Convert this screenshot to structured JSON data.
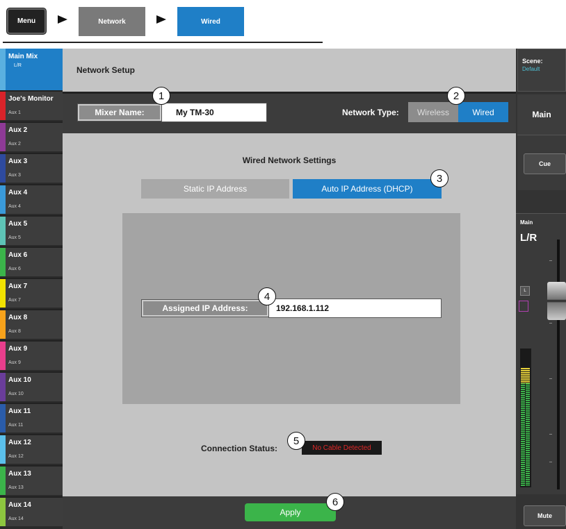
{
  "breadcrumb": {
    "menu": "Menu",
    "network": "Network",
    "wired": "Wired"
  },
  "mixes": {
    "main": {
      "name": "Main Mix",
      "sub": "L/R",
      "color": "#1f7fc7"
    },
    "items": [
      {
        "name": "Joe's Monitor",
        "sub": "Aux 1",
        "color": "#d8232a"
      },
      {
        "name": "Aux 2",
        "sub": "Aux 2",
        "color": "#8e3a96"
      },
      {
        "name": "Aux 3",
        "sub": "Aux 3",
        "color": "#2e4a9e"
      },
      {
        "name": "Aux 4",
        "sub": "Aux 4",
        "color": "#3a9ad9"
      },
      {
        "name": "Aux 5",
        "sub": "Aux 5",
        "color": "#5ec4b6"
      },
      {
        "name": "Aux 6",
        "sub": "Aux 6",
        "color": "#3bb44a"
      },
      {
        "name": "Aux 7",
        "sub": "Aux 7",
        "color": "#f2e200"
      },
      {
        "name": "Aux 8",
        "sub": "Aux 8",
        "color": "#f7a21b"
      },
      {
        "name": "Aux 9",
        "sub": "Aux 9",
        "color": "#e83e8c"
      },
      {
        "name": "Aux 10",
        "sub": "Aux 10",
        "color": "#6a3d9a"
      },
      {
        "name": "Aux 11",
        "sub": "Aux 11",
        "color": "#2a5caa"
      },
      {
        "name": "Aux 12",
        "sub": "Aux 12",
        "color": "#5bc0eb"
      },
      {
        "name": "Aux 13",
        "sub": "Aux 13",
        "color": "#3bb44a"
      },
      {
        "name": "Aux 14",
        "sub": "Aux 14",
        "color": "#8dc63f"
      }
    ]
  },
  "page": {
    "title": "Network Setup",
    "mixer_name_label": "Mixer Name:",
    "mixer_name_value": "My TM-30",
    "network_type_label": "Network Type:",
    "wireless_label": "Wireless",
    "wired_label": "Wired",
    "section_title": "Wired Network Settings",
    "static_ip_label": "Static IP Address",
    "dhcp_label": "Auto IP Address (DHCP)",
    "assigned_ip_label": "Assigned IP Address:",
    "assigned_ip_value": "192.168.1.112",
    "connection_status_label": "Connection Status:",
    "connection_status_value": "No Cable Detected",
    "apply_label": "Apply"
  },
  "callouts": [
    "1",
    "2",
    "3",
    "4",
    "5",
    "6"
  ],
  "right_panel": {
    "scene_label": "Scene:",
    "scene_value": "Default",
    "main_tab": "Main",
    "cue": "Cue",
    "fader_title": "Main",
    "fader_channel": "L/R",
    "l_indicator": "L",
    "mute": "Mute"
  },
  "colors": {
    "accent_blue": "#1f7fc7",
    "apply_green": "#3bb44a",
    "status_red": "#e02828"
  }
}
